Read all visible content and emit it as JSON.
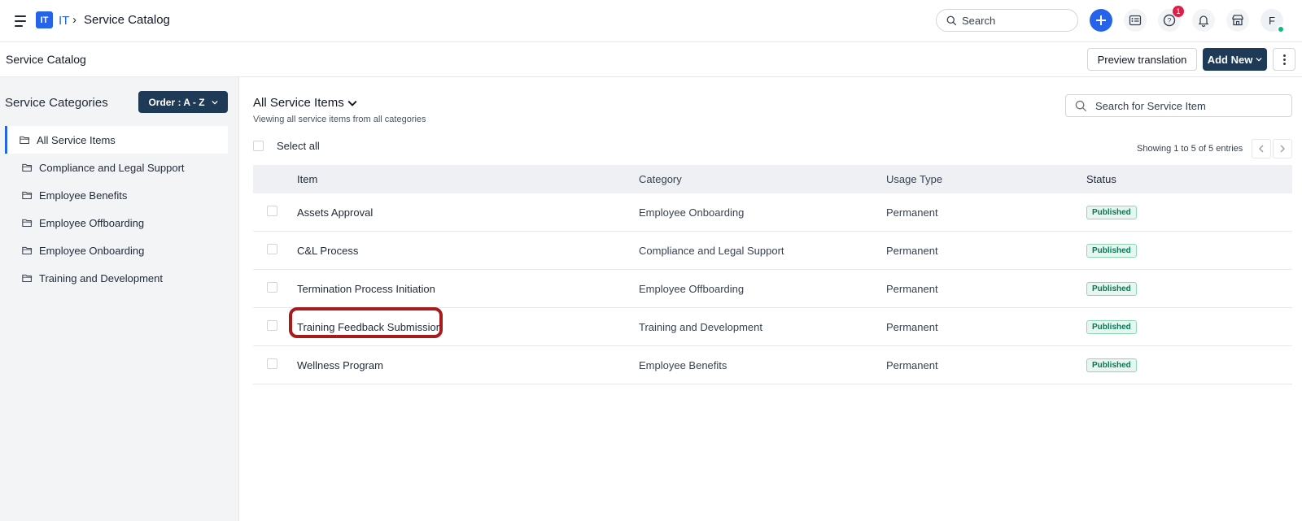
{
  "topbar": {
    "workspace_badge": "IT",
    "workspace_name": "IT",
    "separator": "›",
    "breadcrumb_title": "Service Catalog",
    "search_placeholder": "Search",
    "notification_count": "1",
    "avatar_initial": "F"
  },
  "subheader": {
    "title": "Service Catalog",
    "preview_label": "Preview translation",
    "add_new_label": "Add New"
  },
  "sidebar": {
    "title": "Service Categories",
    "order_label": "Order : A - Z",
    "items": [
      {
        "label": "All Service Items",
        "active": true
      },
      {
        "label": "Compliance and Legal Support",
        "active": false
      },
      {
        "label": "Employee Benefits",
        "active": false
      },
      {
        "label": "Employee Offboarding",
        "active": false
      },
      {
        "label": "Employee Onboarding",
        "active": false
      },
      {
        "label": "Training and Development",
        "active": false
      }
    ]
  },
  "main": {
    "title": "All Service Items",
    "subtitle": "Viewing all service items from all categories",
    "search_placeholder": "Search for Service Item",
    "select_all_label": "Select all",
    "showing_text": "Showing 1 to 5 of 5 entries",
    "columns": [
      "Item",
      "Category",
      "Usage Type",
      "Status"
    ],
    "rows": [
      {
        "item": "Assets Approval",
        "category": "Employee Onboarding",
        "usage": "Permanent",
        "status": "Published",
        "highlighted": false
      },
      {
        "item": "C&L Process",
        "category": "Compliance and Legal Support",
        "usage": "Permanent",
        "status": "Published",
        "highlighted": false
      },
      {
        "item": "Termination Process Initiation",
        "category": "Employee Offboarding",
        "usage": "Permanent",
        "status": "Published",
        "highlighted": false
      },
      {
        "item": "Training Feedback Submission",
        "category": "Training and Development",
        "usage": "Permanent",
        "status": "Published",
        "highlighted": true
      },
      {
        "item": "Wellness Program",
        "category": "Employee Benefits",
        "usage": "Permanent",
        "status": "Published",
        "highlighted": false
      }
    ]
  },
  "colors": {
    "accent": "#2563eb",
    "dark_button": "#1e3a56",
    "published_text": "#047857",
    "highlight_ring": "#a61b1b"
  }
}
